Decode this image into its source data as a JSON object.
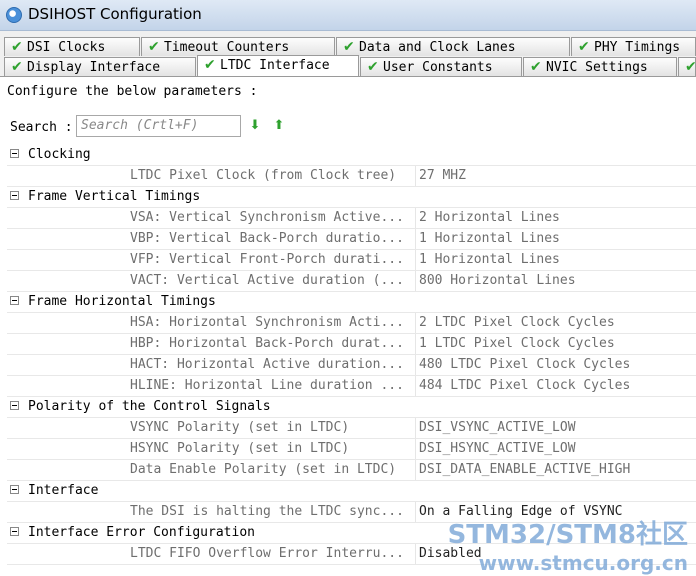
{
  "window": {
    "title": "DSIHOST Configuration"
  },
  "tabs_row1": [
    {
      "label": "DSI Clocks"
    },
    {
      "label": "Timeout Counters"
    },
    {
      "label": "Data and Clock Lanes"
    },
    {
      "label": "PHY Timings"
    }
  ],
  "tabs_row2": [
    {
      "label": "Display Interface"
    },
    {
      "label": "LTDC Interface",
      "active": true
    },
    {
      "label": "User Constants"
    },
    {
      "label": "NVIC Settings"
    }
  ],
  "configure_text": "Configure the below parameters :",
  "search": {
    "label": "Search :",
    "placeholder": "Search (Crtl+F)"
  },
  "groups": [
    {
      "name": "Clocking",
      "params": [
        {
          "name": "LTDC Pixel Clock (from Clock tree)",
          "value": "27 MHZ"
        }
      ]
    },
    {
      "name": "Frame Vertical Timings",
      "params": [
        {
          "name": "VSA: Vertical Synchronism Active...",
          "value": "2 Horizontal Lines"
        },
        {
          "name": "VBP: Vertical Back-Porch duratio...",
          "value": "1 Horizontal Lines"
        },
        {
          "name": "VFP: Vertical Front-Porch durati...",
          "value": "1 Horizontal Lines"
        },
        {
          "name": "VACT: Vertical Active duration (...",
          "value": "800 Horizontal Lines"
        }
      ]
    },
    {
      "name": "Frame Horizontal Timings",
      "params": [
        {
          "name": "HSA: Horizontal Synchronism Acti...",
          "value": "2 LTDC Pixel Clock Cycles"
        },
        {
          "name": "HBP: Horizontal Back-Porch durat...",
          "value": "1 LTDC Pixel Clock Cycles"
        },
        {
          "name": "HACT: Horizontal Active duration...",
          "value": "480 LTDC Pixel Clock Cycles"
        },
        {
          "name": "HLINE: Horizontal Line duration ...",
          "value": "484 LTDC Pixel Clock Cycles"
        }
      ]
    },
    {
      "name": "Polarity of the Control Signals",
      "params": [
        {
          "name": "VSYNC Polarity (set in LTDC)",
          "value": "DSI_VSYNC_ACTIVE_LOW"
        },
        {
          "name": "HSYNC Polarity (set in LTDC)",
          "value": "DSI_HSYNC_ACTIVE_LOW"
        },
        {
          "name": "Data Enable Polarity (set in LTDC)",
          "value": "DSI_DATA_ENABLE_ACTIVE_HIGH"
        }
      ]
    },
    {
      "name": "Interface",
      "params": [
        {
          "name": "The DSI is halting the LTDC sync...",
          "value": "On a Falling Edge of VSYNC",
          "editable": true
        }
      ]
    },
    {
      "name": "Interface Error Configuration",
      "params": [
        {
          "name": "LTDC FIFO Overflow Error Interru...",
          "value": "Disabled",
          "editable": true
        }
      ]
    }
  ],
  "watermark": {
    "line1": "STM32/STM8社区",
    "line2": "www.stmcu.org.cn"
  }
}
